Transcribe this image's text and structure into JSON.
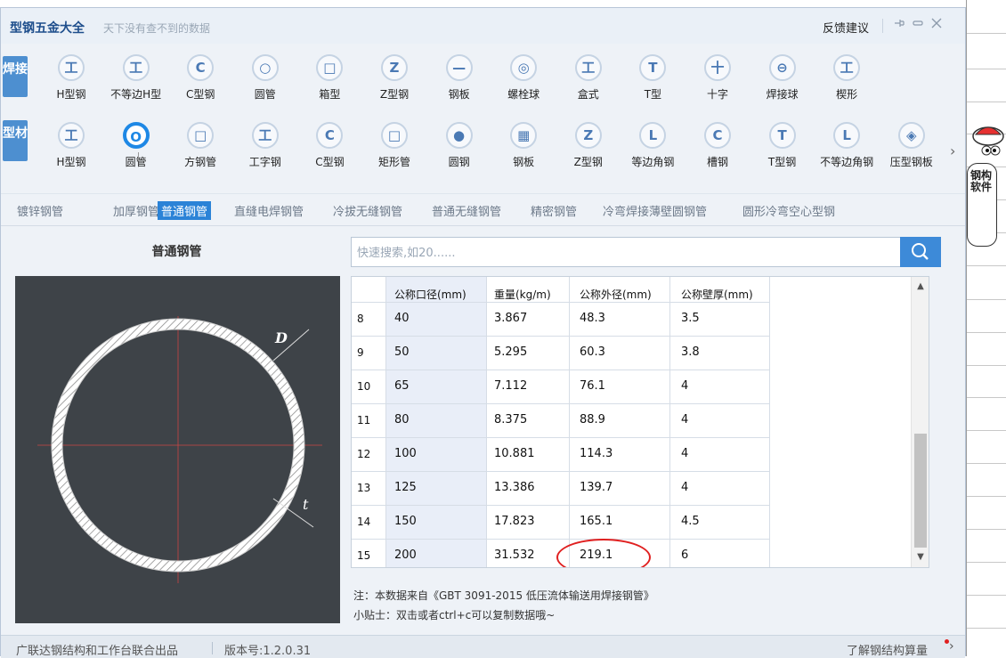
{
  "window": {
    "title": "型钢五金大全",
    "slogan": "天下没有查不到的数据",
    "feedback": "反馈建议",
    "pin_icon": "pin-icon",
    "minimize_icon": "minimize-icon",
    "close_icon": "close-icon"
  },
  "weld_row": {
    "label": "焊接",
    "items": [
      {
        "label": "H型钢",
        "glyph": "工"
      },
      {
        "label": "不等边H型",
        "glyph": "工"
      },
      {
        "label": "C型钢",
        "glyph": "C"
      },
      {
        "label": "圆管",
        "glyph": "○"
      },
      {
        "label": "箱型",
        "glyph": "□"
      },
      {
        "label": "Z型钢",
        "glyph": "Z"
      },
      {
        "label": "钢板",
        "glyph": "—"
      },
      {
        "label": "螺栓球",
        "glyph": "◎"
      },
      {
        "label": "盒式",
        "glyph": "工"
      },
      {
        "label": "T型",
        "glyph": "T"
      },
      {
        "label": "十字",
        "glyph": "十"
      },
      {
        "label": "焊接球",
        "glyph": "⊖"
      },
      {
        "label": "楔形",
        "glyph": "工"
      }
    ]
  },
  "profile_row": {
    "label": "型材",
    "items": [
      {
        "label": "H型钢",
        "glyph": "工"
      },
      {
        "label": "圆管",
        "glyph": "O"
      },
      {
        "label": "方钢管",
        "glyph": "□"
      },
      {
        "label": "工字钢",
        "glyph": "工"
      },
      {
        "label": "C型钢",
        "glyph": "C"
      },
      {
        "label": "矩形管",
        "glyph": "□"
      },
      {
        "label": "圆钢",
        "glyph": "●"
      },
      {
        "label": "钢板",
        "glyph": "▦"
      },
      {
        "label": "Z型钢",
        "glyph": "Z"
      },
      {
        "label": "等边角钢",
        "glyph": "L"
      },
      {
        "label": "槽钢",
        "glyph": "C"
      },
      {
        "label": "T型钢",
        "glyph": "T"
      },
      {
        "label": "不等边角钢",
        "glyph": "L"
      },
      {
        "label": "压型钢板",
        "glyph": "◈"
      }
    ]
  },
  "categories": [
    "镀锌钢管",
    "加厚钢管",
    "普通钢管",
    "直缝电焊钢管",
    "冷拔无缝钢管",
    "普通无缝钢管",
    "精密钢管",
    "冷弯焊接薄壁圆钢管",
    "圆形冷弯空心型钢"
  ],
  "active_category": "普通钢管",
  "diagram": {
    "title": "普通钢管",
    "label_d": "D",
    "label_t": "t"
  },
  "search": {
    "placeholder": "快速搜索,如20......",
    "icon": "search-icon"
  },
  "table": {
    "columns": [
      "公称口径(mm)",
      "重量(kg/m)",
      "公称外径(mm)",
      "公称壁厚(mm)"
    ],
    "rows": [
      {
        "n": "8",
        "c": [
          "40",
          "3.867",
          "48.3",
          "3.5"
        ]
      },
      {
        "n": "9",
        "c": [
          "50",
          "5.295",
          "60.3",
          "3.8"
        ]
      },
      {
        "n": "10",
        "c": [
          "65",
          "7.112",
          "76.1",
          "4"
        ]
      },
      {
        "n": "11",
        "c": [
          "80",
          "8.375",
          "88.9",
          "4"
        ]
      },
      {
        "n": "12",
        "c": [
          "100",
          "10.881",
          "114.3",
          "4"
        ]
      },
      {
        "n": "13",
        "c": [
          "125",
          "13.386",
          "139.7",
          "4"
        ]
      },
      {
        "n": "14",
        "c": [
          "150",
          "17.823",
          "165.1",
          "4.5"
        ]
      },
      {
        "n": "15",
        "c": [
          "200",
          "31.532",
          "219.1",
          "6"
        ]
      }
    ]
  },
  "notes": {
    "source": "注：本数据来自《GBT 3091-2015 低压流体输送用焊接钢管》",
    "tip": "小贴士：双击或者ctrl+c可以复制数据哦~"
  },
  "footer": {
    "publisher": "广联达钢结构和工作台联合出品",
    "version": "版本号:1.2.0.31",
    "learn_more": "了解钢结构算量"
  },
  "mascot": {
    "text": "钢构软件"
  },
  "colors": {
    "accent": "#2b83d7",
    "highlight": "#e02020",
    "label_bg": "#4d8fd0"
  }
}
